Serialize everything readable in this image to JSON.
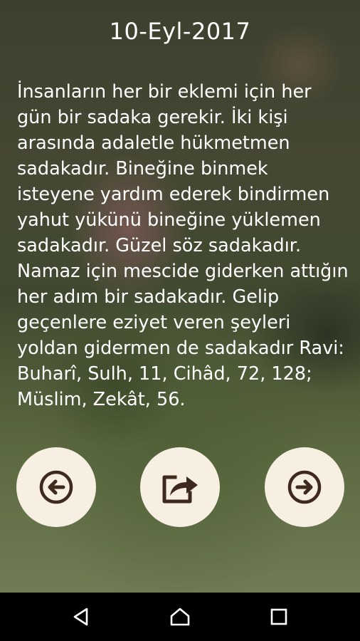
{
  "header": {
    "date": "10-Eyl-2017"
  },
  "content": {
    "text": "İnsanların her bir eklemi için her gün bir sadaka gerekir. İki kişi arasında adaletle hükmetmen sadakadır. Bineğine binmek isteyene yardım ederek bindirmen yahut yükünü bineğine yüklemen sadakadır. Güzel söz sadakadır. Namaz için mescide giderken attığın her adım bir sadakadır. Gelip geçenlere eziyet veren şeyleri yoldan gidermen de sadakadır Ravi: Buharî, Sulh, 11, Cihâd, 72, 128; Müslim, Zekât, 56."
  },
  "buttons": {
    "prev_icon": "arrow-left-circle-icon",
    "share_icon": "share-icon",
    "next_icon": "arrow-right-circle-icon"
  },
  "system_nav": {
    "back_icon": "back-triangle-icon",
    "home_icon": "home-icon",
    "recents_icon": "recents-square-icon"
  },
  "colors": {
    "button_bg": "#f6efe2",
    "icon_color": "#3e2a1c",
    "text_color": "#ffffff",
    "system_bar": "#000000"
  }
}
